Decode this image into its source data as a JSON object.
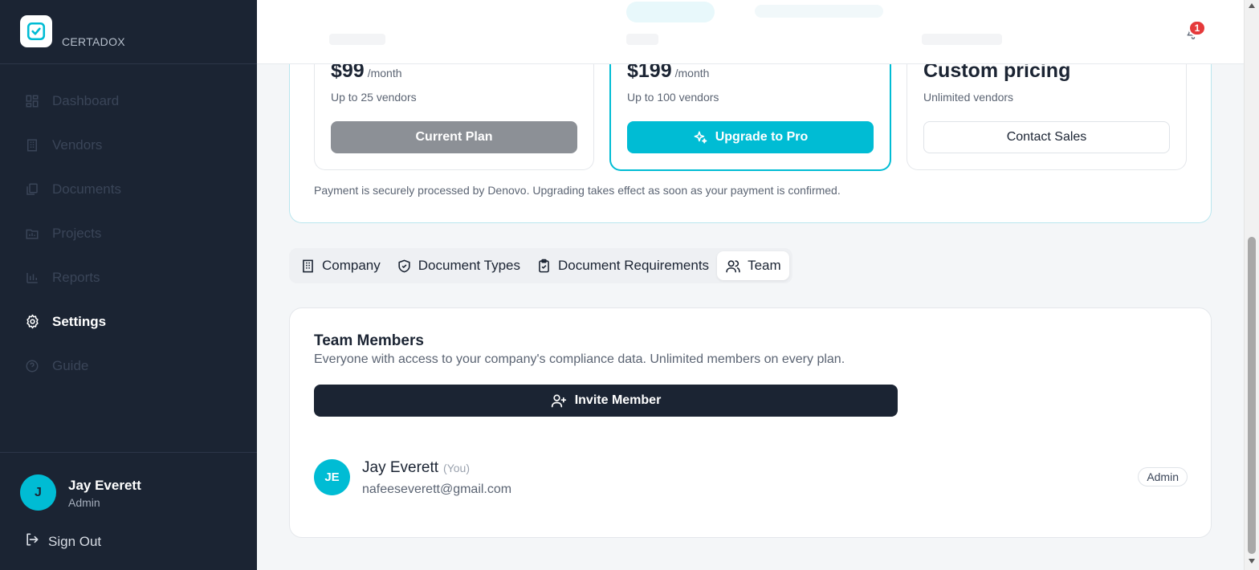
{
  "brand": {
    "name": "CERTADOX"
  },
  "nav": [
    {
      "label": "Dashboard",
      "icon": "dashboard-icon"
    },
    {
      "label": "Vendors",
      "icon": "building-icon"
    },
    {
      "label": "Documents",
      "icon": "documents-icon"
    },
    {
      "label": "Projects",
      "icon": "folder-chart-icon"
    },
    {
      "label": "Reports",
      "icon": "bar-chart-icon"
    },
    {
      "label": "Settings",
      "icon": "gear-icon",
      "active": true
    },
    {
      "label": "Guide",
      "icon": "help-circle-icon"
    }
  ],
  "user": {
    "initial": "J",
    "name": "Jay Everett",
    "role": "Admin",
    "sign_out": "Sign Out"
  },
  "notifications": {
    "count": "1"
  },
  "plans": [
    {
      "price": "$99",
      "unit": "/month",
      "subtitle": "Up to 25 vendors",
      "button": "Current Plan"
    },
    {
      "price": "$199",
      "unit": "/month",
      "subtitle": "Up to 100 vendors",
      "button": "Upgrade to Pro"
    },
    {
      "price": "Custom pricing",
      "unit": "",
      "subtitle": "Unlimited vendors",
      "button": "Contact Sales"
    }
  ],
  "payment_note": "Payment is securely processed by Denovo. Upgrading takes effect as soon as your payment is confirmed.",
  "tabs": [
    {
      "label": "Company",
      "icon": "building-icon"
    },
    {
      "label": "Document Types",
      "icon": "shield-check-icon"
    },
    {
      "label": "Document Requirements",
      "icon": "clipboard-check-icon"
    },
    {
      "label": "Team",
      "icon": "users-icon",
      "active": true
    }
  ],
  "team": {
    "title": "Team Members",
    "description": "Everyone with access to your company's compliance data. Unlimited members on every plan.",
    "invite_label": "Invite Member",
    "members": [
      {
        "initials": "JE",
        "name": "Jay Everett",
        "you_label": "(You)",
        "email": "nafeeseverett@gmail.com",
        "role": "Admin"
      }
    ]
  },
  "colors": {
    "accent": "#00bcd4",
    "sidebar": "#1b2433",
    "badge": "#e5393a"
  }
}
